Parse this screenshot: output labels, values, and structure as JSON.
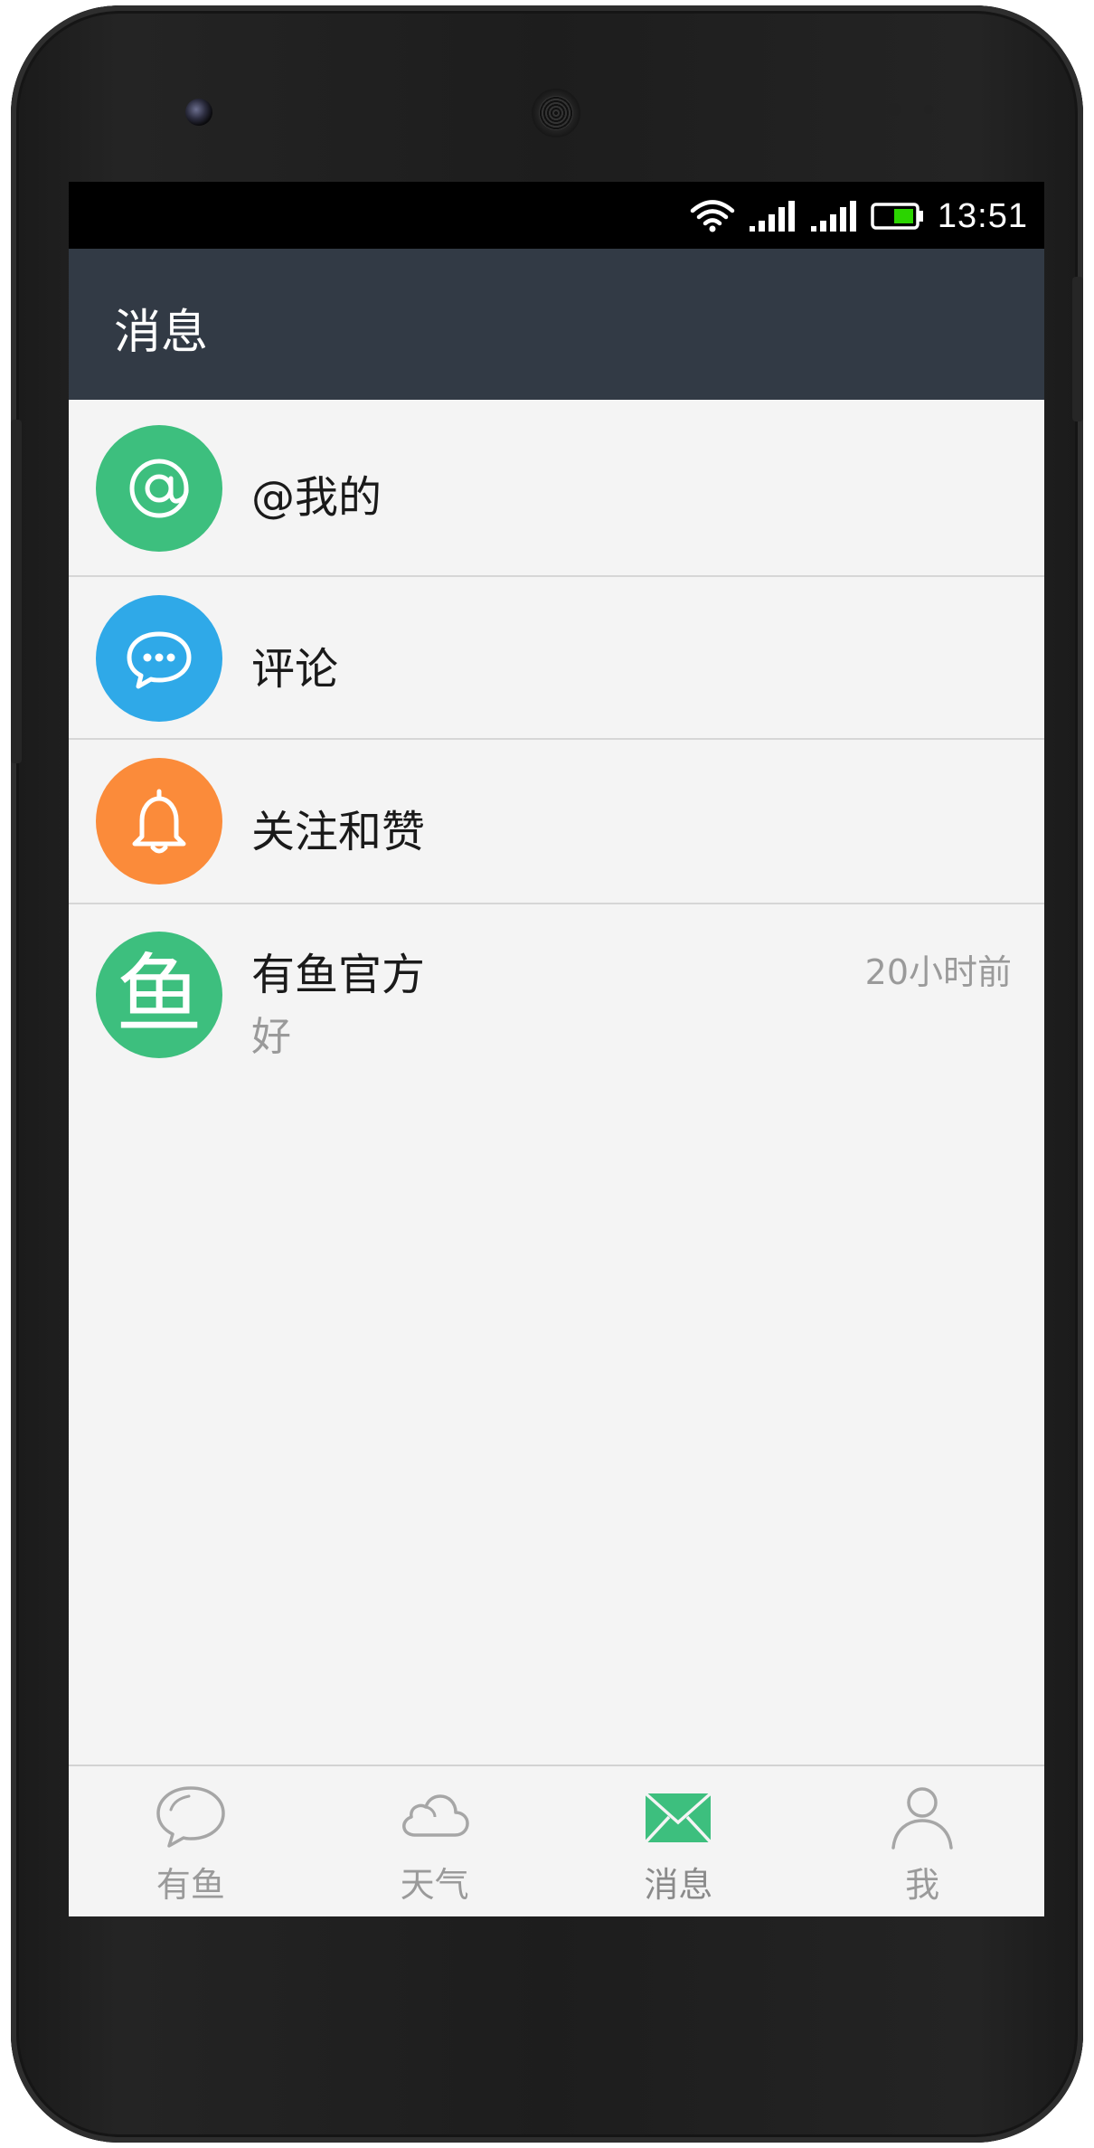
{
  "status_bar": {
    "time": "13:51",
    "icons": [
      "wifi-icon",
      "signal-icon",
      "signal-icon",
      "battery-icon"
    ],
    "battery_color": "#2bd400"
  },
  "app_bar": {
    "title": "消息",
    "background": "#323a45"
  },
  "messages": {
    "rows": [
      {
        "title": "@我的",
        "icon": "at-icon",
        "color": "#3dbf7e"
      },
      {
        "title": "评论",
        "icon": "comment-icon",
        "color": "#2fa9e8"
      },
      {
        "title": "关注和赞",
        "icon": "bell-icon",
        "color": "#fb8b3a"
      },
      {
        "title": "有鱼官方",
        "subtitle": "好",
        "time": "20小时前",
        "icon_glyph": "鱼",
        "color": "#3dbf7e"
      }
    ]
  },
  "bottom_nav": {
    "active_color": "#3dbf7e",
    "items": [
      {
        "label": "有鱼",
        "icon": "chat-bubble-icon"
      },
      {
        "label": "天气",
        "icon": "cloud-icon"
      },
      {
        "label": "消息",
        "icon": "envelope-icon",
        "active": true
      },
      {
        "label": "我",
        "icon": "person-icon"
      }
    ]
  }
}
